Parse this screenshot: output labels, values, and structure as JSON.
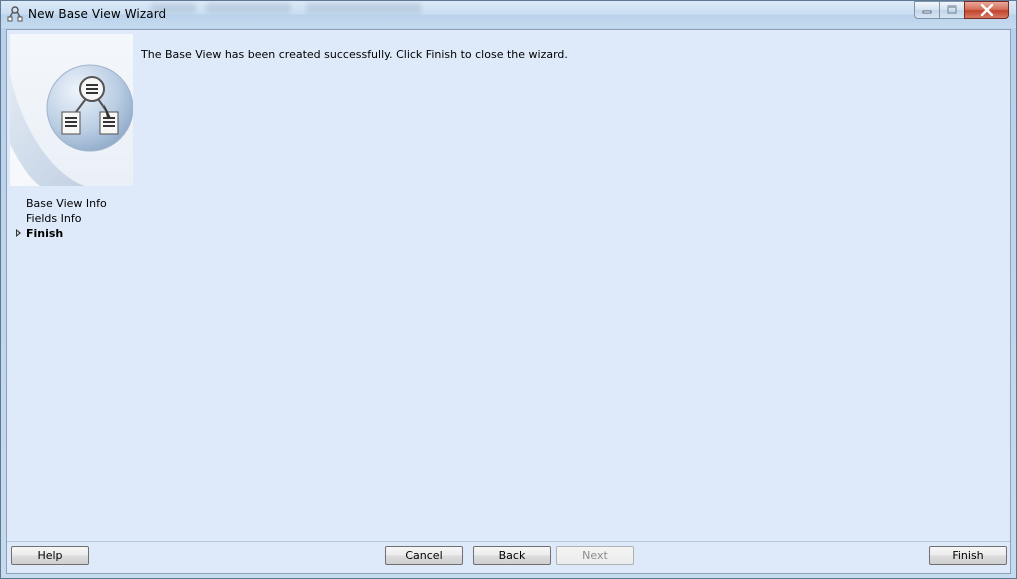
{
  "window": {
    "title": "New Base View Wizard"
  },
  "sidebar": {
    "steps": [
      {
        "label": "Base View Info",
        "current": false
      },
      {
        "label": "Fields Info",
        "current": false
      },
      {
        "label": "Finish",
        "current": true
      }
    ]
  },
  "main": {
    "message": "The Base View has been created successfully. Click Finish to close the wizard."
  },
  "buttons": {
    "help": "Help",
    "cancel": "Cancel",
    "back": "Back",
    "next": "Next",
    "finish": "Finish"
  },
  "icons": {
    "title": "wizard-app-icon",
    "wizard_graphic": "base-view-diagram-icon",
    "current_step": "triangle-right-icon"
  },
  "colors": {
    "content_background": "#deeafa",
    "close_button": "#c1452d"
  }
}
